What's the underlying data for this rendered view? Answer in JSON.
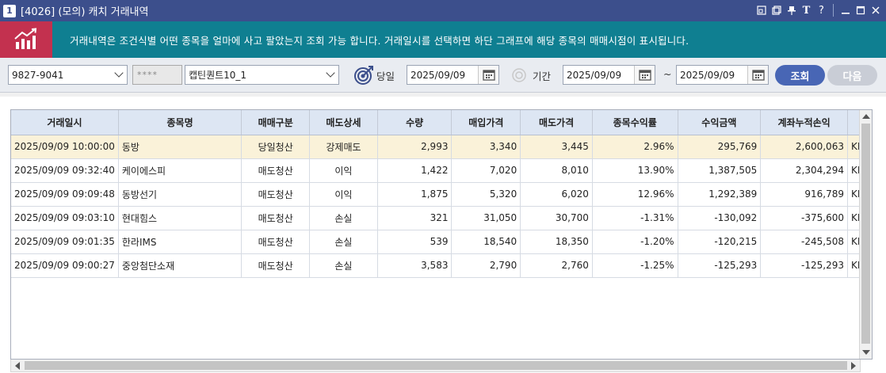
{
  "window": {
    "number": "1",
    "title": "[4026] (모의) 캐치 거래내역"
  },
  "banner": {
    "message": "거래내역은 조건식별 어떤 종목을 얼마에 사고 팔았는지 조회 가능 합니다. 거래일시를 선택하면 하단 그래프에 해당 종목의 매매시점이 표시됩니다."
  },
  "toolbar": {
    "account": "9827-9041",
    "password": "****",
    "strategy": "캡틴퀀트10_1",
    "today_label": "당일",
    "today_date": "2025/09/09",
    "period_label": "기간",
    "period_from": "2025/09/09",
    "period_sep": "~",
    "period_to": "2025/09/09",
    "query_label": "조회",
    "next_label": "다음"
  },
  "table": {
    "columns": [
      "거래일시",
      "종목명",
      "매매구분",
      "매도상세",
      "수량",
      "매입가격",
      "매도가격",
      "종목수익률",
      "수익금액",
      "계좌누적손익"
    ],
    "rows": [
      [
        "2025/09/09 10:00:00",
        "동방",
        "당일청산",
        "강제매도",
        "2,993",
        "3,340",
        "3,445",
        "2.96%",
        "295,769",
        "2,600,063",
        "KF"
      ],
      [
        "2025/09/09 09:32:40",
        "케이에스피",
        "매도청산",
        "이익",
        "1,422",
        "7,020",
        "8,010",
        "13.90%",
        "1,387,505",
        "2,304,294",
        "KF"
      ],
      [
        "2025/09/09 09:09:48",
        "동방선기",
        "매도청산",
        "이익",
        "1,875",
        "5,320",
        "6,020",
        "12.96%",
        "1,292,389",
        "916,789",
        "KF"
      ],
      [
        "2025/09/09 09:03:10",
        "현대힘스",
        "매도청산",
        "손실",
        "321",
        "31,050",
        "30,700",
        "-1.31%",
        "-130,092",
        "-375,600",
        "KF"
      ],
      [
        "2025/09/09 09:01:35",
        "한라IMS",
        "매도청산",
        "손실",
        "539",
        "18,540",
        "18,350",
        "-1.20%",
        "-120,215",
        "-245,508",
        "KF"
      ],
      [
        "2025/09/09 09:00:27",
        "중앙첨단소재",
        "매도청산",
        "손실",
        "3,583",
        "2,790",
        "2,760",
        "-1.25%",
        "-125,293",
        "-125,293",
        "KF"
      ]
    ]
  },
  "colors": {
    "titlebar": "#3c4f8c",
    "banner": "#0f7f91",
    "logo": "#c3314f",
    "selected_row": "#faf2d9",
    "header": "#dde6f3",
    "query_button": "#4866b5"
  }
}
